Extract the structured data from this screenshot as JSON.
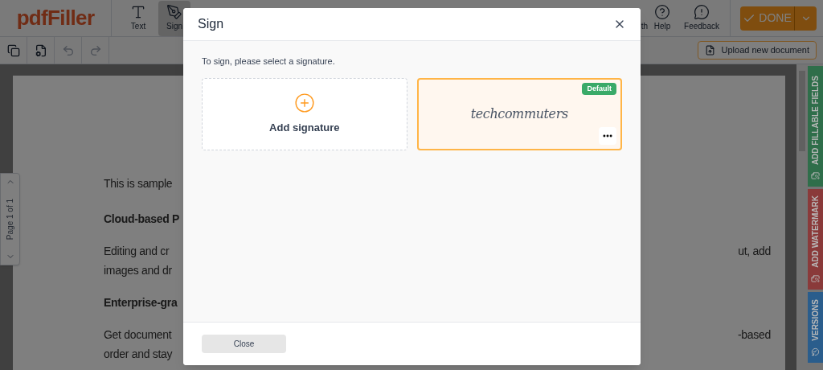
{
  "app": {
    "logo": "pdfFiller"
  },
  "toolbar": {
    "tools": [
      {
        "label": "Text",
        "selected": false
      },
      {
        "label": "Sign",
        "selected": true
      }
    ],
    "right_tools": [
      {
        "label": "th"
      },
      {
        "label": "Help"
      },
      {
        "label": "Feedback"
      }
    ],
    "done_button": "DONE"
  },
  "secondary_toolbar": {
    "upload_button": "Upload new document"
  },
  "page_nav": {
    "label": "Page 1 of 1"
  },
  "document": {
    "lines": [
      {
        "kind": "paragraph",
        "text": "This is sample"
      },
      {
        "kind": "heading",
        "text": "Cloud-based P"
      },
      {
        "kind": "paragraph",
        "text": "Editing and cr",
        "right_text": "ut, add"
      },
      {
        "kind": "paragraph",
        "text": "images and dr"
      },
      {
        "kind": "heading",
        "text": "Enterprise-gra"
      },
      {
        "kind": "paragraph",
        "text": "Get document",
        "right_text": "-based"
      },
      {
        "kind": "paragraph",
        "text": "order and stay"
      }
    ]
  },
  "side_tabs": [
    {
      "label": "ADD FILLABLE FIELDS",
      "color": "#2f6e4a"
    },
    {
      "label": "ADD WATERMARK",
      "color": "#8a3a3a"
    },
    {
      "label": "VERSIONS",
      "color": "#2a5d8c"
    }
  ],
  "dialog": {
    "title": "Sign",
    "instruction": "To sign, please select a signature.",
    "signatures": [
      {
        "kind": "add",
        "label": "Add signature"
      },
      {
        "kind": "signature",
        "text": "techcommuters",
        "badge": "Default",
        "selected": true
      }
    ],
    "close_button": "Close"
  }
}
